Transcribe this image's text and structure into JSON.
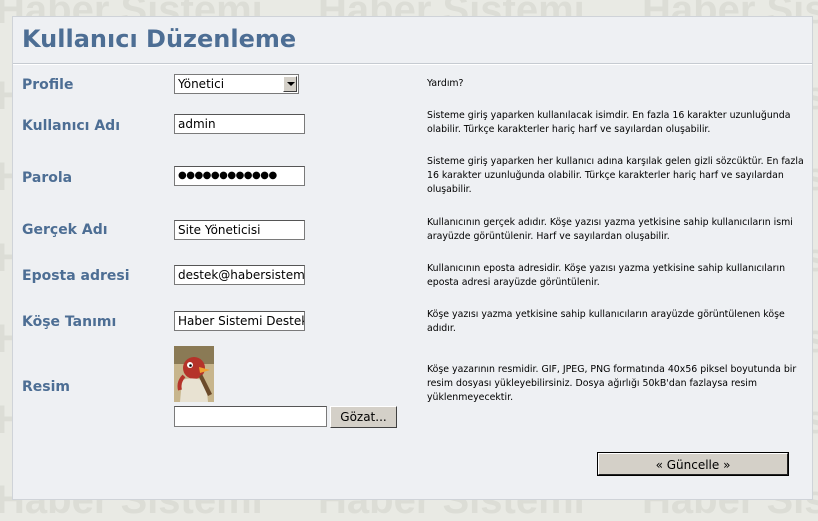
{
  "watermark_text": "Haber Sistemi",
  "page": {
    "title": "Kullanıcı Düzenleme",
    "help_heading": "Yardım?"
  },
  "form": {
    "profile": {
      "label": "Profile",
      "value": "Yönetici",
      "help": ""
    },
    "username": {
      "label": "Kullanıcı Adı",
      "value": "admin",
      "help": "Sisteme giriş yaparken kullanılacak isimdir. En fazla 16 karakter uzunluğunda olabilir. Türkçe karakterler hariç harf ve sayılardan oluşabilir."
    },
    "password": {
      "label": "Parola",
      "value": "●●●●●●●●●●●●",
      "help": "Sisteme giriş yaparken her kullanıcı adına karşılak gelen gizli sözcüktür. En fazla 16 karakter uzunluğunda olabilir. Türkçe karakterler hariç harf ve sayılardan oluşabilir."
    },
    "realname": {
      "label": "Gerçek Adı",
      "value": "Site Yöneticisi",
      "help": "Kullanıcının gerçek adıdır. Köşe yazısı yazma yetkisine sahip kullanıcıların ismi arayüzde görüntülenir. Harf ve sayılardan oluşabilir."
    },
    "email": {
      "label": "Eposta adresi",
      "value": "destek@habersistemi.",
      "help": "Kullanıcının eposta adresidir. Köşe yazısı yazma yetkisine sahip kullanıcıların eposta adresi arayüzde görüntülenir."
    },
    "column": {
      "label": "Köşe Tanımı",
      "value": "Haber Sistemi Destek",
      "help": "Köşe yazısı yazma yetkisine sahip kullanıcıların arayüzde görüntülenen köşe adıdır."
    },
    "image": {
      "label": "Resim",
      "file_value": "",
      "browse_label": "Gözat...",
      "help": "Köşe yazarının resmidir. GIF, JPEG, PNG formatında 40x56 piksel boyutunda bir resim dosyası yükleyebilirsiniz. Dosya ağırlığı 50kB'dan fazlaysa resim yüklenmeyecektir."
    }
  },
  "actions": {
    "update_label": "«  Güncelle  »"
  },
  "colors": {
    "accent": "#4d6e94",
    "panel": "#eef0f3",
    "background": "#e9eae4"
  }
}
